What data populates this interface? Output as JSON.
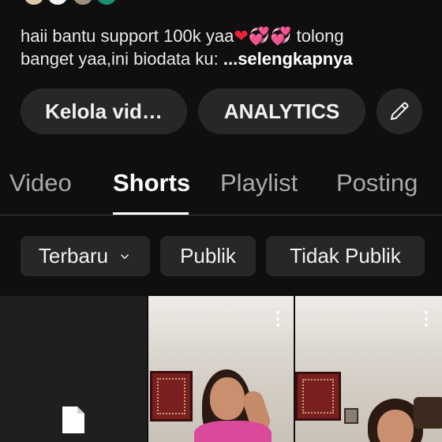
{
  "channel": {
    "description_line1": "haii bantu support 100k yaa",
    "description_emoji": "❤💞💞",
    "description_line1_end": "tolong",
    "description_line2": "banget yaa,ini biodata ku: ",
    "more_label": "...selengkapnya"
  },
  "actions": {
    "manage_videos_label": "Kelola vid…",
    "analytics_label": "ANALYTICS",
    "edit_icon": "pencil-icon"
  },
  "tabs": [
    {
      "label": "Video",
      "selected": false
    },
    {
      "label": "Shorts",
      "selected": true
    },
    {
      "label": "Playlist",
      "selected": false
    },
    {
      "label": "Posting",
      "selected": false
    }
  ],
  "filters": {
    "sort_label": "Terbaru",
    "public_label": "Publik",
    "private_label": "Tidak Publik"
  },
  "shorts": [
    {
      "state": "processing",
      "icon": "document-icon"
    },
    {
      "state": "video",
      "menu_icon": "more-vert-icon"
    },
    {
      "state": "video",
      "menu_icon": "more-vert-icon"
    }
  ],
  "colors": {
    "background": "#0f0f0f",
    "pill": "#272727",
    "text": "#f1f1f1",
    "muted_text": "#aaaaaa"
  }
}
